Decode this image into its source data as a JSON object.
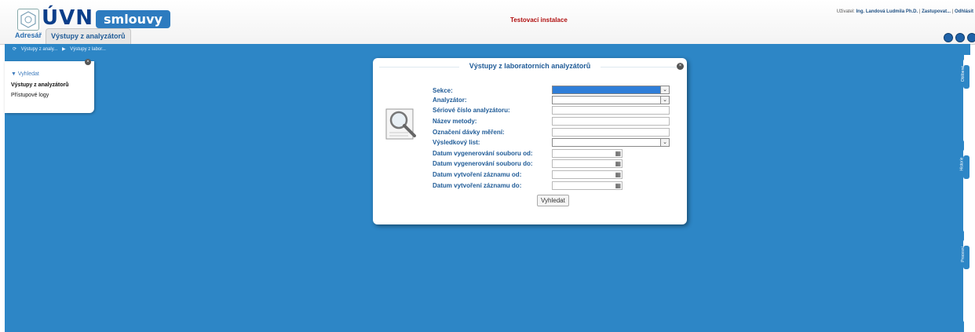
{
  "header": {
    "logo_text": "ÚVN",
    "logo_badge": "smlouvy",
    "env_title": "Testovací instalace",
    "user_prefix": "Uživatel:",
    "user_name": "Ing. Landová Ludmila Ph.D.",
    "substitute_link": "Zastupovat...",
    "logout_link": "Odhlásit"
  },
  "tabs": {
    "adresar": "Adresář",
    "vystupy": "Výstupy z analyzátorů"
  },
  "breadcrumb": {
    "item1": "Výstupy z analy...",
    "item2": "Výstupy z labor..."
  },
  "sidebar": {
    "header": "Vyhledat",
    "items": [
      "Výstupy z analyzátorů",
      "Přístupové logy"
    ]
  },
  "right_tabs": [
    "Oblíbené",
    "Historie",
    "Procesní"
  ],
  "dialog": {
    "title": "Výstupy z laboratorních analyzátorů",
    "fields": [
      {
        "label": "Sekce:",
        "type": "select",
        "value": ""
      },
      {
        "label": "Analyzátor:",
        "type": "select",
        "value": ""
      },
      {
        "label": "Sériové číslo analyzátoru:",
        "type": "text",
        "value": ""
      },
      {
        "label": "Název metody:",
        "type": "text",
        "value": ""
      },
      {
        "label": "Označení dávky měření:",
        "type": "text",
        "value": ""
      },
      {
        "label": "Výsledkový list:",
        "type": "select",
        "value": ""
      },
      {
        "label": "Datum vygenerování souboru od:",
        "type": "date",
        "value": ""
      },
      {
        "label": "Datum vygenerování souboru do:",
        "type": "date",
        "value": ""
      },
      {
        "label": "Datum vytvoření záznamu od:",
        "type": "date",
        "value": ""
      },
      {
        "label": "Datum vytvoření záznamu do:",
        "type": "date",
        "value": ""
      }
    ],
    "search_button": "Vyhledat"
  }
}
